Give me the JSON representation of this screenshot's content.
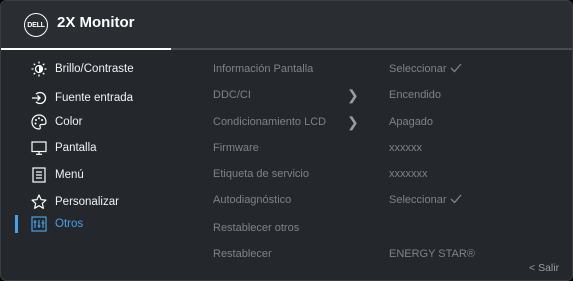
{
  "header": {
    "logo_text": "DELL",
    "title": "2X Monitor"
  },
  "sidebar": {
    "items": [
      {
        "label": "Brillo/Contraste",
        "icon": "brightness-icon"
      },
      {
        "label": "Fuente entrada",
        "icon": "input-source-icon"
      },
      {
        "label": "Color",
        "icon": "color-icon"
      },
      {
        "label": "Pantalla",
        "icon": "display-icon"
      },
      {
        "label": "Menú",
        "icon": "menu-icon"
      },
      {
        "label": "Personalizar",
        "icon": "star-icon"
      },
      {
        "label": "Otros",
        "icon": "others-icon",
        "active": true
      }
    ]
  },
  "content": {
    "rows": [
      {
        "label": "Información Pantalla",
        "value": "Seleccionar",
        "check": true,
        "arrow": false
      },
      {
        "label": "DDC/CI",
        "value": "Encendido",
        "check": false,
        "arrow": true
      },
      {
        "label": "Condicionamiento LCD",
        "value": "Apagado",
        "check": false,
        "arrow": true
      },
      {
        "label": "Firmware",
        "value": "xxxxxx",
        "check": false,
        "arrow": false
      },
      {
        "label": "Etiqueta de servicio",
        "value": "xxxxxxx",
        "check": false,
        "arrow": false
      },
      {
        "label": "Autodiagnóstico",
        "value": "Seleccionar",
        "check": true,
        "arrow": false
      },
      {
        "label": "Restablecer otros",
        "value": "",
        "check": false,
        "arrow": false
      },
      {
        "label": "Restablecer",
        "value": "ENERGY STAR®",
        "check": false,
        "arrow": false
      }
    ]
  },
  "footer": {
    "exit_label": "Salir",
    "exit_icon": "chevron-left-icon"
  },
  "colors": {
    "background": "#24272c",
    "accent": "#4aa0e6",
    "text": "#f2f2f2",
    "muted_text": "#7f8389"
  }
}
